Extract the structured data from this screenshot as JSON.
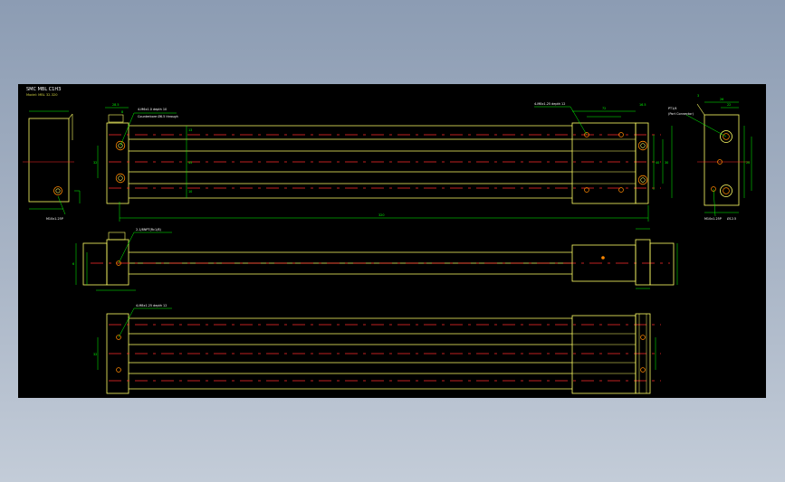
{
  "drawing": {
    "title": "SMC MBL C1H3",
    "subtitle": "Model: MBL 32-320",
    "colors": {
      "background": "#000000",
      "outline": "#ffff66",
      "dimension": "#00ff00",
      "centerline": "#ff2a2a",
      "port": "#ff8800",
      "note_text": "#ffffff"
    },
    "notes": {
      "top_left_port": "4-M6x1.0 depth 10",
      "top_left_port_2": "Counterbore Ø6.5 through",
      "top_right_port": "4-M8x1.25 depth 12",
      "side_port": "2-1/8NPT(Rc1/8)",
      "bottom_port": "4-M8x1.25 depth 12",
      "right_port": "PT1/4",
      "right_port_2": "(Port Connector)",
      "end_label_left": "M10x1.25P",
      "end_label_right": "M10x1.25P",
      "end_label_right_2": "Ø12.5"
    },
    "dims": {
      "overall_length": "320",
      "d_28_5": "28.5",
      "d_8": "8",
      "d_32": "32",
      "d_45": "45",
      "d_30": "30",
      "d_40": "40",
      "d_13": "13",
      "d_10": "10",
      "d_16_5": "16.5",
      "d_72": "72",
      "d_3": "3",
      "d_26": "26",
      "d_22": "22",
      "d_6": "6",
      "d_20": "20"
    }
  }
}
